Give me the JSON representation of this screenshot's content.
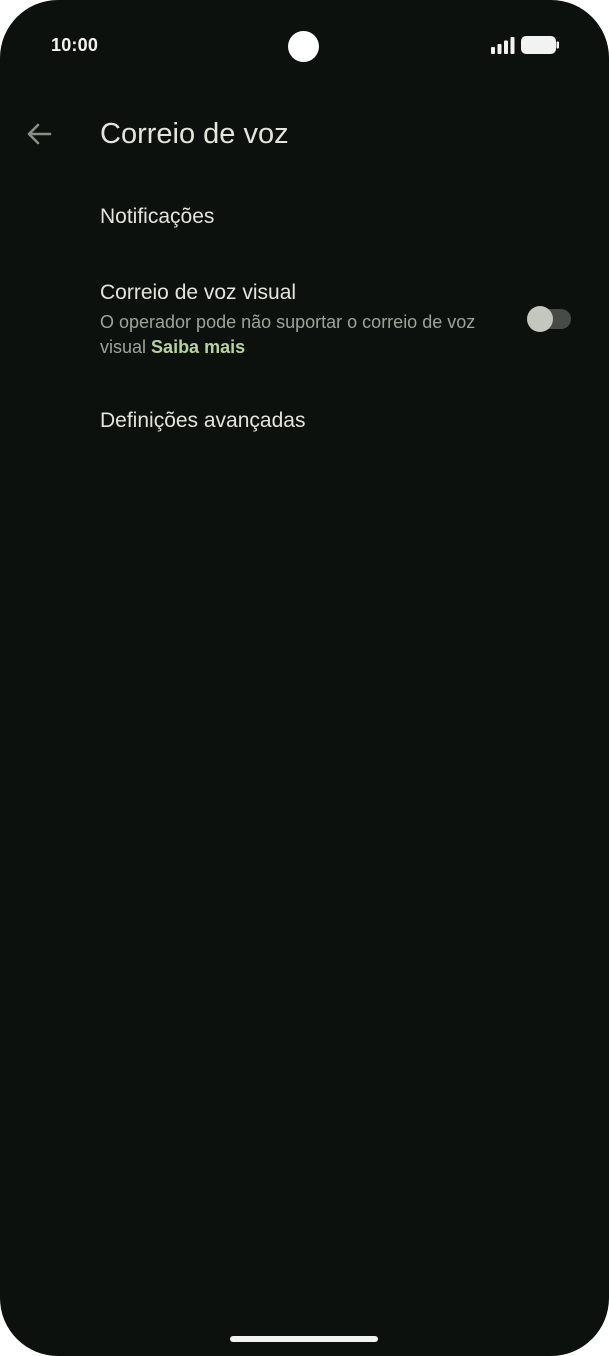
{
  "status_bar": {
    "time": "10:00",
    "signal_icon": "signal-bars-icon",
    "battery_icon": "battery-icon"
  },
  "app_bar": {
    "back_icon": "arrow-back-icon",
    "title": "Correio de voz"
  },
  "settings": {
    "notifications": {
      "title": "Notificações"
    },
    "visual_voicemail": {
      "title": "Correio de voz visual",
      "summary": "O operador pode não suportar o correio de voz visual",
      "link": "Saiba mais",
      "enabled": false
    },
    "advanced": {
      "title": "Definições avançadas"
    }
  },
  "colors": {
    "background": "#0c110d",
    "primary_text": "#e3e4dc",
    "secondary_text": "#9ea39a",
    "accent_link": "#b8d39e"
  }
}
